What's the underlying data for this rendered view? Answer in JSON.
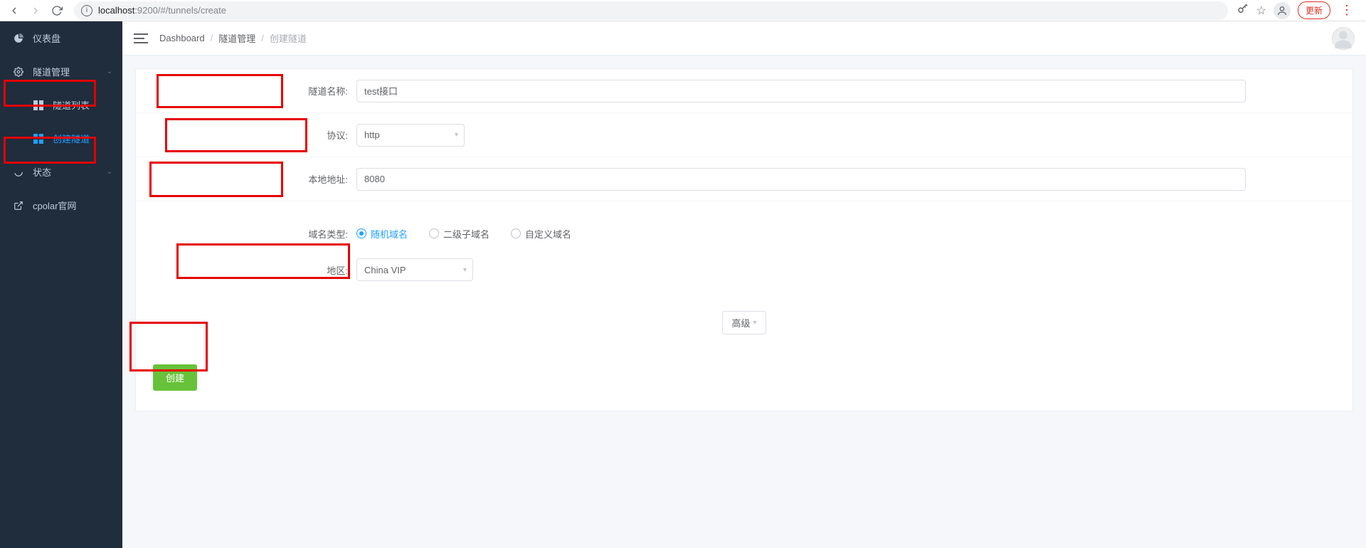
{
  "browser": {
    "url_host": "localhost",
    "url_port": ":9200",
    "url_path": "/#/tunnels/create",
    "update_label": "更新"
  },
  "sidebar": {
    "items": [
      {
        "label": "仪表盘"
      },
      {
        "label": "隧道管理"
      },
      {
        "label": "隧道列表"
      },
      {
        "label": "创建隧道"
      },
      {
        "label": "状态"
      },
      {
        "label": "cpolar官网"
      }
    ]
  },
  "breadcrumb": {
    "items": [
      "Dashboard",
      "隧道管理",
      "创建隧道"
    ]
  },
  "form": {
    "tunnel_name_label": "隧道名称:",
    "tunnel_name_value": "test接口",
    "protocol_label": "协议:",
    "protocol_value": "http",
    "local_addr_label": "本地地址:",
    "local_addr_value": "8080",
    "domain_type_label": "域名类型:",
    "domain_types": [
      {
        "label": "随机域名",
        "checked": true
      },
      {
        "label": "二级子域名",
        "checked": false
      },
      {
        "label": "自定义域名",
        "checked": false
      }
    ],
    "region_label": "地区:",
    "region_value": "China VIP",
    "advanced_label": "高级",
    "submit_label": "创建"
  }
}
